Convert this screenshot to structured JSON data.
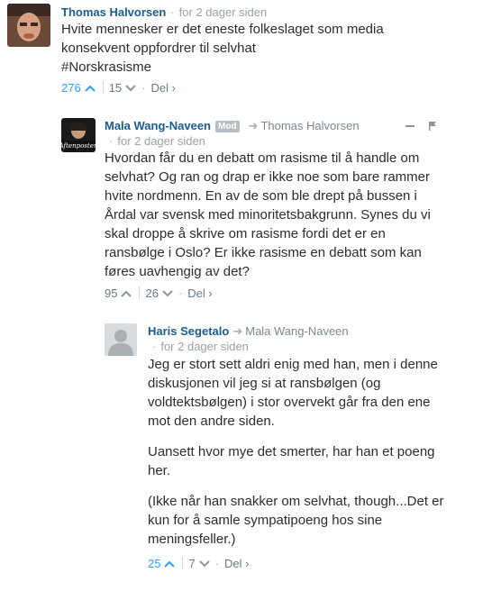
{
  "comments": [
    {
      "author": "Thomas Halvorsen",
      "time": "for 2 dager siden",
      "text": [
        "Hvite mennesker er det eneste folkeslaget som media konsekvent oppfordrer til selvhat",
        "#Norskrasisme"
      ],
      "upvotes": "276",
      "downvotes": "15",
      "share": "Del"
    },
    {
      "author": "Mala Wang-Naveen",
      "badge": "Mod",
      "reply_to": "Thomas Halvorsen",
      "time": "for 2 dager siden",
      "avatar_text": "Aftenposten",
      "text": [
        "Hvordan får du en debatt om rasisme til å handle om selvhat? Og ran og drap er ikke noe som bare rammer hvite nordmenn. En av de som ble drept på bussen i Årdal var svensk med minoritetsbakgrunn. Synes du vi skal droppe å skrive om rasisme fordi det er en ransbølge i Oslo? Er ikke rasisme en debatt som kan føres uavhengig av det?"
      ],
      "upvotes": "95",
      "downvotes": "26",
      "share": "Del"
    },
    {
      "author": "Haris Segetalo",
      "reply_to": "Mala Wang-Naveen",
      "time": "for 2 dager siden",
      "text": [
        "Jeg er stort sett aldri enig med han, men i denne diskusjonen vil jeg si at ransbølgen (og voldtektsbølgen) i stor overvekt går fra den ene mot den andre siden.",
        "Uansett hvor mye det smerter, har han et poeng her.",
        "(Ikke når han snakker om selvhat, though...Det er kun for å samle sympatipoeng hos sine meningsfeller.)"
      ],
      "upvotes": "25",
      "downvotes": "7",
      "share": "Del"
    }
  ],
  "colors": {
    "author": "#1a5d8f",
    "upvote_active": "#2e9fff",
    "meta": "#9aa2a6"
  }
}
